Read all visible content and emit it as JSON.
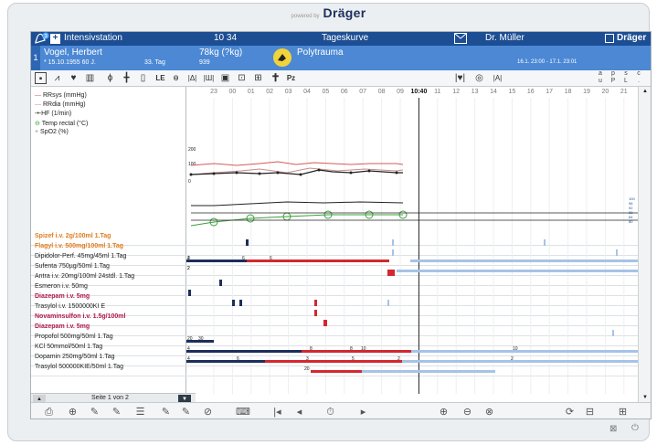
{
  "device": {
    "brand_prefix": "powered by",
    "brand": "Dräger",
    "bottom_icons": [
      "keyboard-icon",
      "power-icon"
    ]
  },
  "titlebar": {
    "badge": "3",
    "app": "Intensivstation",
    "time": "10 34",
    "view": "Tageskurve",
    "user": "Dr. Müller",
    "logo": "Dräger"
  },
  "patient": {
    "index": "1",
    "name": "Vogel, Herbert",
    "dob_age": "* 15.10.1955   60 J.",
    "day": "33. Tag",
    "weight": "78kg (?kg)",
    "weight_sub": "939",
    "diagnosis": "Polytrauma",
    "period": "16.1. 23:00 - 17.1. 23:01",
    "colors": {
      "title": "#1d4e93",
      "patient": "#4c88d4",
      "warning": "#f2d33a"
    }
  },
  "toolbar": {
    "le_label": "LE",
    "pz_label": "Pz",
    "side_labels": [
      [
        "a",
        "u"
      ],
      [
        "p",
        "P"
      ],
      [
        "s",
        "L"
      ],
      [
        "c",
        "."
      ]
    ]
  },
  "timeline": {
    "hours": [
      "23",
      "00",
      "01",
      "02",
      "03",
      "04",
      "05",
      "06",
      "07",
      "08",
      "09",
      "10:40",
      "11",
      "12",
      "13",
      "14",
      "15",
      "16",
      "17",
      "18",
      "19",
      "20",
      "21",
      "22"
    ],
    "current": "10:40"
  },
  "vitals": {
    "labels": [
      "RRsys (mmHg)",
      "RRdia (mmHg)",
      "HF (1/min)",
      "Temp rectal (°C)",
      "SpO2 (%)"
    ],
    "scale_labels": [
      "200",
      "100",
      "0"
    ],
    "spo2_scale": [
      "100",
      "96",
      "92",
      "88",
      "84",
      "80"
    ],
    "colors": {
      "rrsys": "#d65a5a",
      "rrdia": "#c88a8a",
      "hf": "#222222",
      "temp": "#3aa03a",
      "spo2": "#222222"
    }
  },
  "medications": [
    {
      "label": "Spizef i.v. 2g/100ml 1.Tag",
      "color": "#e07b1d",
      "bold": true
    },
    {
      "label": "Flagyl i.v. 500mg/100ml 1.Tag",
      "color": "#e07b1d",
      "bold": true
    },
    {
      "label": "Dipidolor-Perf. 45mg/45ml 1.Tag",
      "color": "#222",
      "bold": false,
      "values": [
        "2",
        "4",
        "6",
        "6"
      ]
    },
    {
      "label": "Sufenta 750µg/50ml 1.Tag",
      "color": "#222",
      "bold": false,
      "values": [
        "2",
        "2"
      ]
    },
    {
      "label": "Antra i.v. 20mg/100ml 24stdl. 1.Tag",
      "color": "#222",
      "bold": false
    },
    {
      "label": "Esmeron i.v. 50mg",
      "color": "#222",
      "bold": false
    },
    {
      "label": "Diazepam i.v. 5mg",
      "color": "#b0184a",
      "bold": true
    },
    {
      "label": "Trasylol i.v. 1500000KI E",
      "color": "#222",
      "bold": false
    },
    {
      "label": "Novaminsulfon i.v. 1.5g/100ml",
      "color": "#b0184a",
      "bold": true
    },
    {
      "label": "Diazepam i.v. 5mg",
      "color": "#b0184a",
      "bold": true
    },
    {
      "label": "Propofol 500mg/50ml 1.Tag",
      "color": "#222",
      "bold": false,
      "values": [
        "20",
        "30"
      ]
    },
    {
      "label": "KCl 50mmol/50ml 1.Tag",
      "color": "#222",
      "bold": false,
      "values": [
        "4",
        "8",
        "8",
        "10",
        "10"
      ]
    },
    {
      "label": "Dopamin 250mg/50ml 1.Tag",
      "color": "#222",
      "bold": false,
      "values": [
        "4",
        "6",
        "3",
        "5",
        "2",
        "2"
      ]
    },
    {
      "label": "Trasylol 500000KIE/50ml 1.Tag",
      "color": "#222",
      "bold": false,
      "values": [
        "20"
      ]
    }
  ],
  "pager": {
    "label": "Seite 1 von 2"
  },
  "bottombar": {
    "icons": [
      "print-icon",
      "add-entry-icon",
      "edit-icon",
      "edit-settings-icon",
      "comment-icon",
      "edit-disabled-icon",
      "edit-check-icon",
      "approve-icon",
      "keyboard-icon",
      "skip-back-icon",
      "step-back-icon",
      "clock-icon",
      "step-forward-icon",
      "zoom-in-icon",
      "zoom-out-icon",
      "zoom-reset-icon",
      "lock-refresh-icon",
      "lock-icon",
      "grid-icon"
    ]
  }
}
